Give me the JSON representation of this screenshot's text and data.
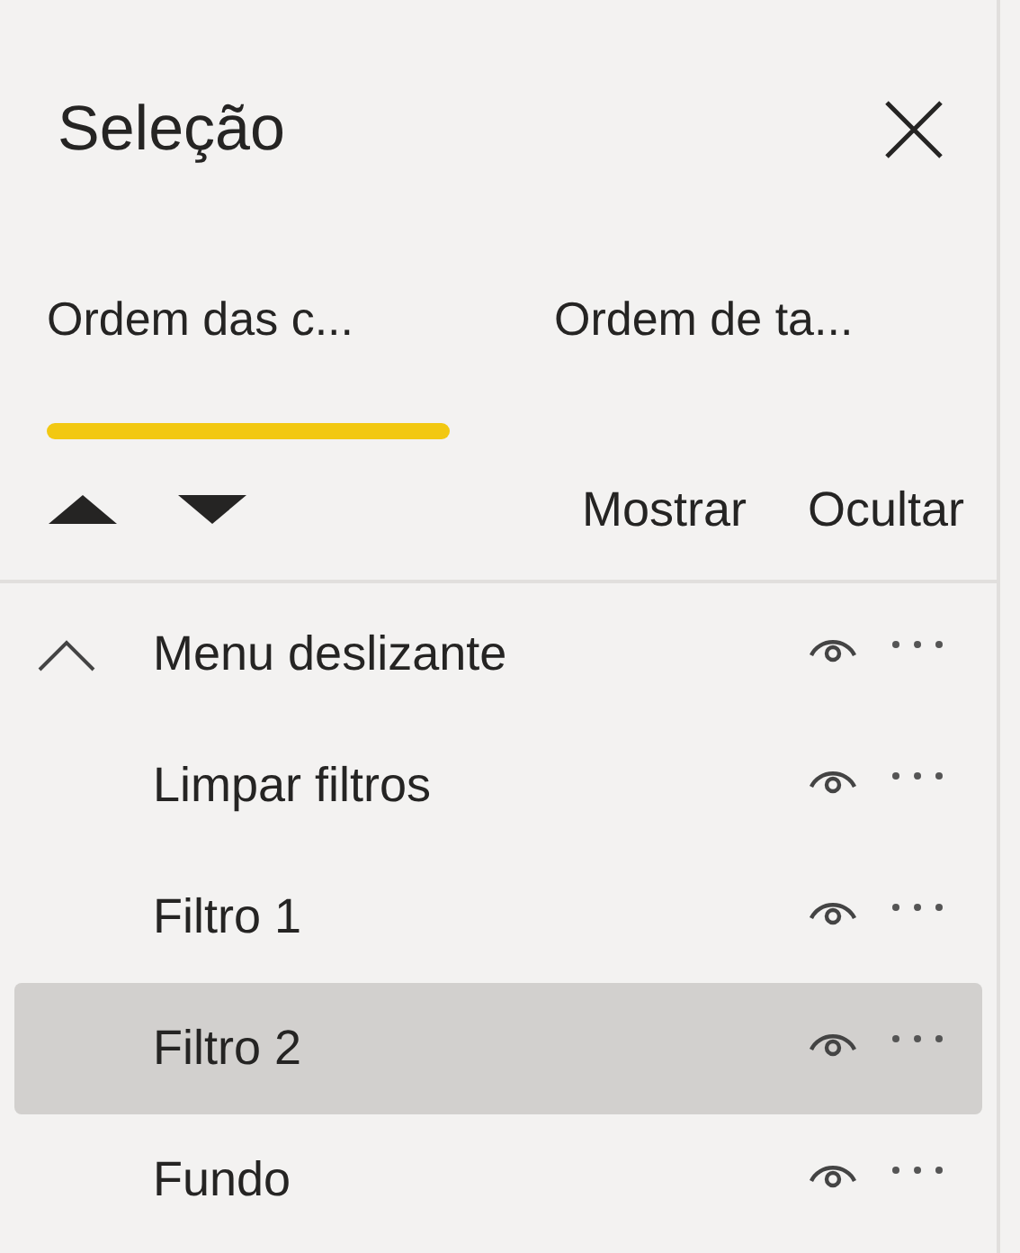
{
  "panel": {
    "title": "Seleção"
  },
  "tabs": [
    {
      "label": "Ordem das c...",
      "selected": true
    },
    {
      "label": "Ordem de ta...",
      "selected": false
    }
  ],
  "toolbar": {
    "show_label": "Mostrar",
    "hide_label": "Ocultar"
  },
  "layers": [
    {
      "name": "Menu deslizante",
      "expanded": true,
      "selected": false,
      "children": [
        {
          "name": "Limpar filtros",
          "selected": false
        },
        {
          "name": "Filtro 1",
          "selected": false
        },
        {
          "name": "Filtro 2",
          "selected": true
        },
        {
          "name": "Fundo",
          "selected": false
        }
      ]
    }
  ]
}
